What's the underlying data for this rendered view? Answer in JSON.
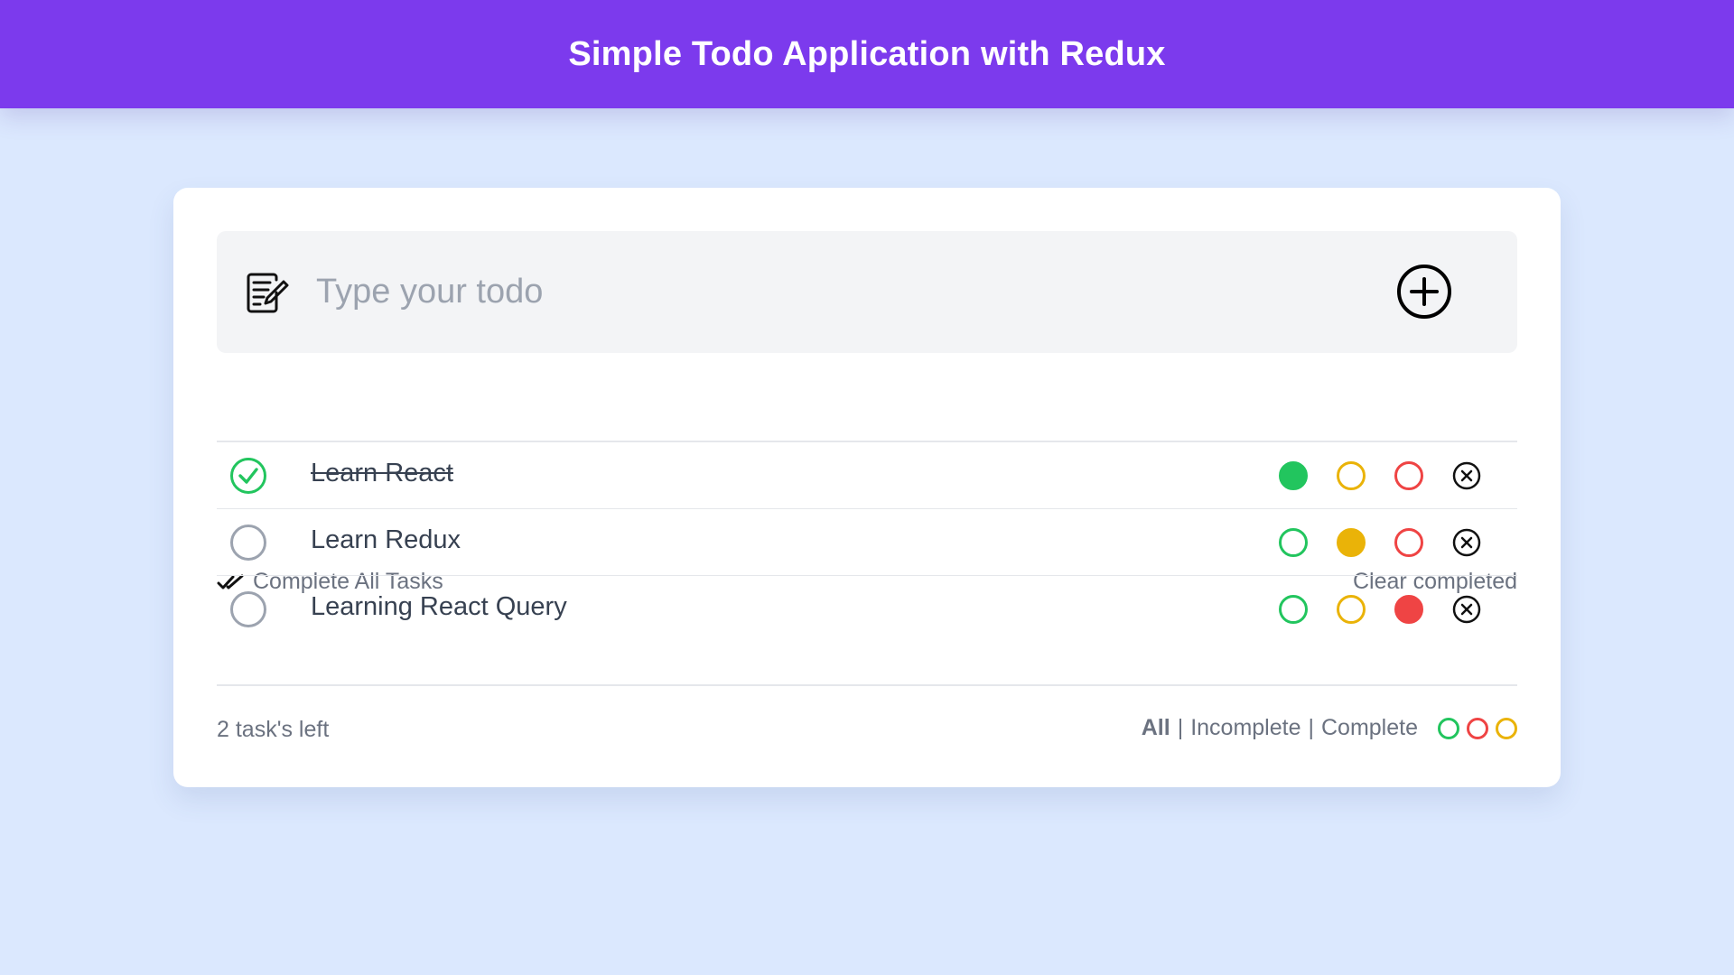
{
  "header": {
    "title": "Simple Todo Application with Redux"
  },
  "input": {
    "placeholder": "Type your todo",
    "value": ""
  },
  "toolbar": {
    "complete_all_label": "Complete All Tasks",
    "clear_completed_label": "Clear completed"
  },
  "todos": [
    {
      "text": "Learn React",
      "completed": true,
      "priority": "green"
    },
    {
      "text": "Learn Redux",
      "completed": false,
      "priority": "yellow"
    },
    {
      "text": "Learning React Query",
      "completed": false,
      "priority": "red"
    }
  ],
  "footer": {
    "tasks_left": "2 task's left",
    "filters": [
      {
        "label": "All",
        "active": true
      },
      {
        "label": "Incomplete",
        "active": false
      },
      {
        "label": "Complete",
        "active": false
      }
    ],
    "color_filters": [
      "green",
      "red",
      "yellow"
    ],
    "separator": "|"
  },
  "colors": {
    "header": "#7c3aed",
    "background": "#dbe8fe",
    "green": "#22c55e",
    "yellow": "#eab308",
    "red": "#ef4444"
  },
  "icons": {
    "input": "note-edit-icon",
    "add": "plus-circle-icon",
    "complete_all": "double-check-icon",
    "delete": "close-circle-icon"
  }
}
